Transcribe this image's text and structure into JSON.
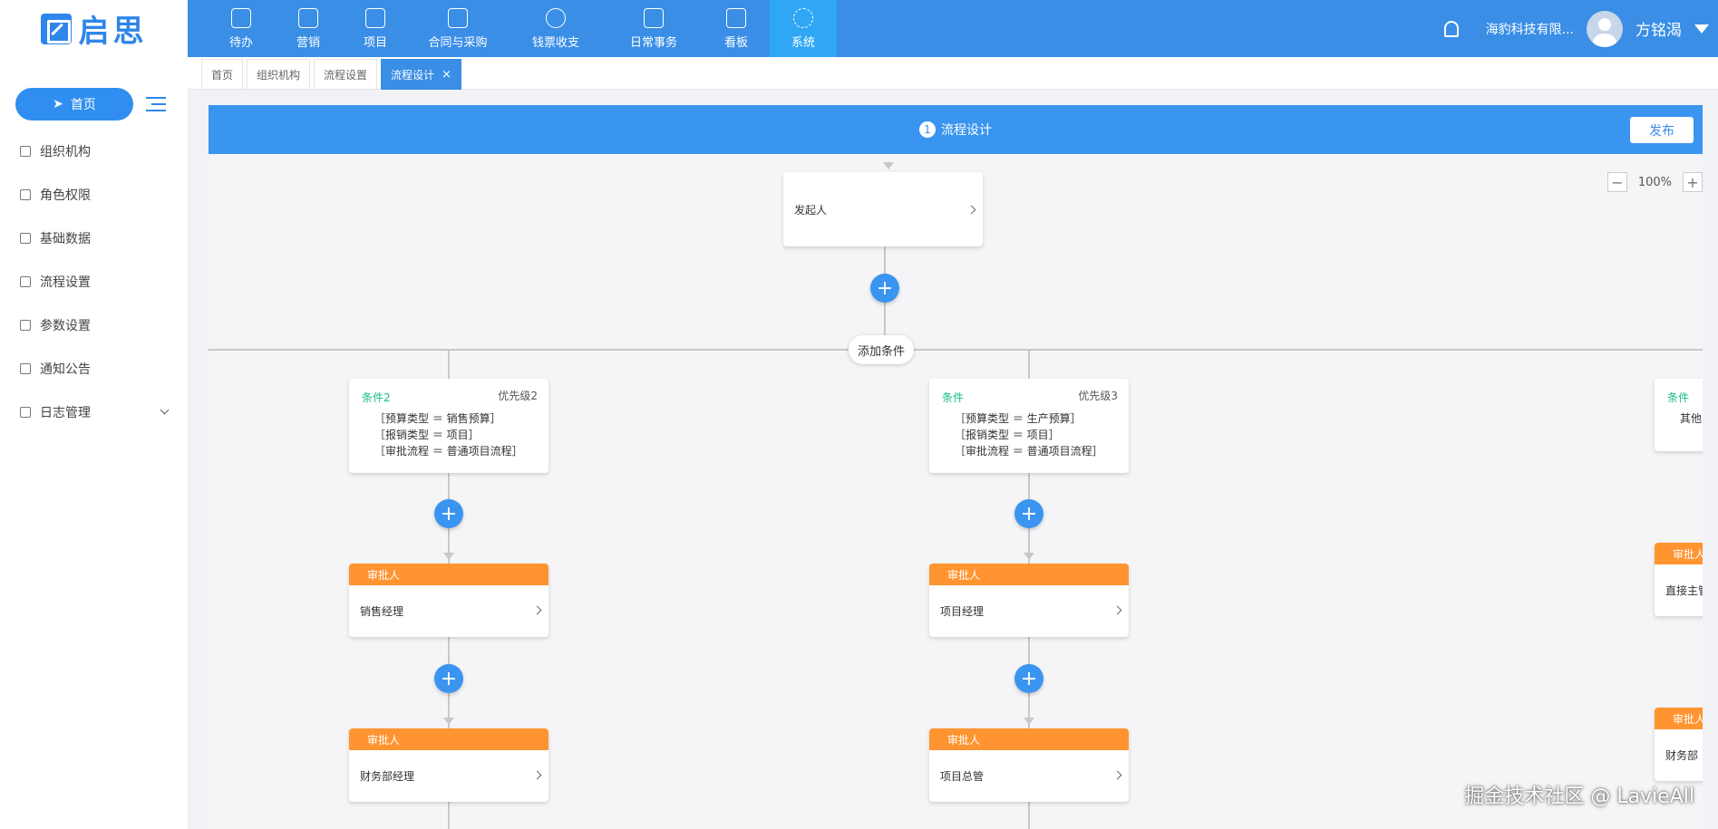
{
  "logo": {
    "text": "启思"
  },
  "sidebar": {
    "home_label": "首页",
    "items": [
      {
        "label": "组织机构"
      },
      {
        "label": "角色权限"
      },
      {
        "label": "基础数据"
      },
      {
        "label": "流程设置"
      },
      {
        "label": "参数设置"
      },
      {
        "label": "通知公告"
      },
      {
        "label": "日志管理"
      }
    ]
  },
  "topnav": {
    "items": [
      {
        "label": "待办"
      },
      {
        "label": "营销"
      },
      {
        "label": "项目"
      },
      {
        "label": "合同与采购"
      },
      {
        "label": "钱票收支"
      },
      {
        "label": "日常事务"
      },
      {
        "label": "看板"
      },
      {
        "label": "系统"
      }
    ],
    "company": "海豹科技有限...",
    "username": "方铭渴"
  },
  "tabs": [
    {
      "label": "首页"
    },
    {
      "label": "组织机构"
    },
    {
      "label": "流程设置"
    },
    {
      "label": "流程设计",
      "close": "×"
    }
  ],
  "designer": {
    "step_number": "1",
    "step_label": "流程设计",
    "publish_label": "发布",
    "zoom_minus": "−",
    "zoom_level": "100%",
    "zoom_plus": "+",
    "start_node": "发起人",
    "plus": "+",
    "add_condition": "添加条件",
    "branches": [
      {
        "cond_title": "条件2",
        "priority": "优先级2",
        "conditions": [
          "［预算类型 ＝ 销售预算］",
          "［报销类型 ＝ 项目］",
          "［审批流程 ＝ 普通项目流程］"
        ],
        "approvers": [
          {
            "head": "审批人",
            "name": "销售经理"
          },
          {
            "head": "审批人",
            "name": "财务部经理"
          }
        ]
      },
      {
        "cond_title": "条件",
        "priority": "优先级3",
        "conditions": [
          "［预算类型 ＝ 生产预算］",
          "［报销类型 ＝ 项目］",
          "［审批流程 ＝ 普通项目流程］"
        ],
        "approvers": [
          {
            "head": "审批人",
            "name": "项目经理"
          },
          {
            "head": "审批人",
            "name": "项目总管"
          }
        ]
      },
      {
        "cond_title": "条件",
        "conditions": [
          "其他"
        ],
        "approvers": [
          {
            "head": "审批人",
            "name": "直接主管"
          },
          {
            "head": "审批人",
            "name": "财务部"
          }
        ]
      }
    ]
  },
  "watermark": "掘金技术社区 @ LavieAll"
}
